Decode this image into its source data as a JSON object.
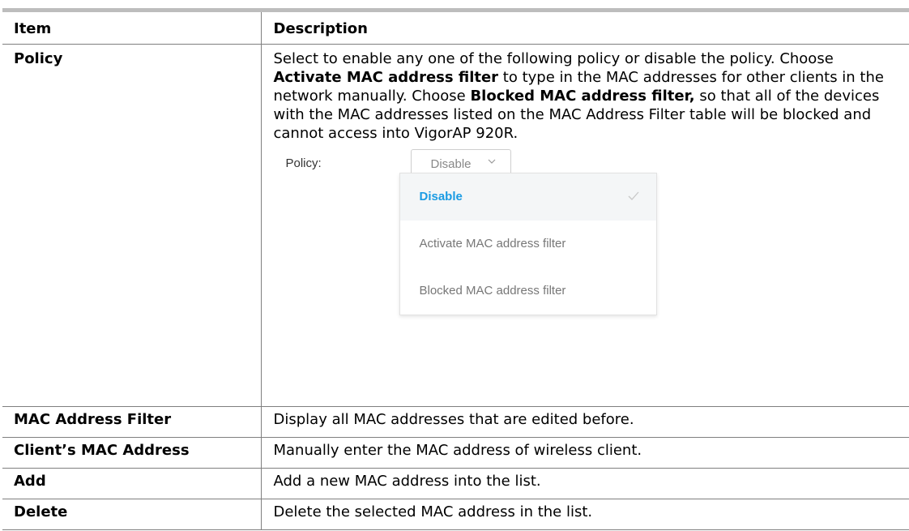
{
  "header": {
    "item": "Item",
    "description": "Description"
  },
  "policy": {
    "item": "Policy",
    "desc_1": "Select to enable any one of the following policy or disable the policy. Choose ",
    "bold_1": "Activate MAC address filter",
    "desc_2": " to type in the MAC addresses for other clients in the network manually. Choose ",
    "bold_2": "Blocked MAC address filter,",
    "desc_3": " so that all of the devices with the MAC addresses listed on the MAC Address Filter table will be blocked and cannot access into VigorAP 920R.",
    "ui": {
      "label": "Policy:",
      "selected_value": "Disable",
      "options": [
        {
          "label": "Disable",
          "selected": true
        },
        {
          "label": "Activate MAC address filter",
          "selected": false
        },
        {
          "label": "Blocked MAC address filter",
          "selected": false
        }
      ],
      "accent_color": "#1a9be3"
    }
  },
  "rows": [
    {
      "item": "MAC Address Filter",
      "description": "Display all MAC addresses that are edited before."
    },
    {
      "item": "Client’s MAC Address",
      "description": "Manually enter the MAC address of wireless client."
    },
    {
      "item": "Add",
      "description": "Add a new MAC address into the list."
    },
    {
      "item": "Delete",
      "description": "Delete the selected MAC address in the list."
    }
  ]
}
